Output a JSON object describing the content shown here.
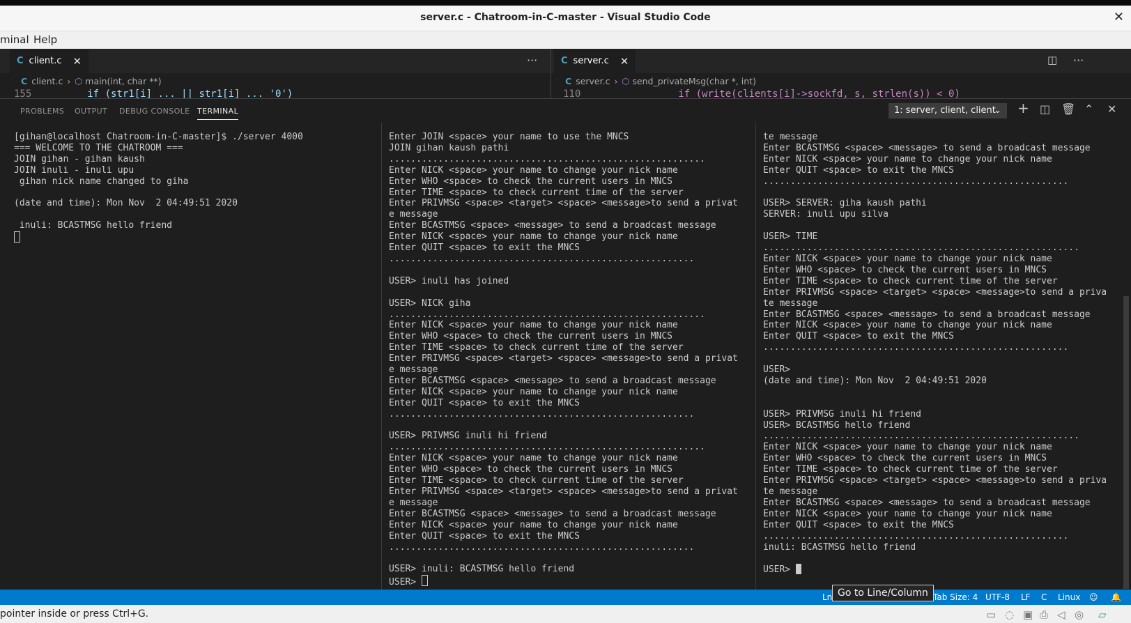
{
  "window": {
    "title": "server.c - Chatroom-in-C-master - Visual Studio Code"
  },
  "menu": [
    "minal",
    "Help"
  ],
  "editor_left": {
    "tab_icon": "C",
    "tab_label": "client.c",
    "breadcrumb_file": "client.c",
    "breadcrumb_symbol": "main(int, char **)",
    "peek_line_no": "155",
    "peek_code": "if (str1[i] ... || str1[i] ... '0')"
  },
  "editor_right": {
    "tab_icon": "C",
    "tab_label": "server.c",
    "breadcrumb_file": "server.c",
    "breadcrumb_symbol": "send_privateMsg(char *, int)",
    "peek_line_no": "110",
    "peek_code": "if (write(clients[i]->sockfd, s, strlen(s)) < 0)"
  },
  "panel": {
    "tabs": [
      "PROBLEMS",
      "OUTPUT",
      "DEBUG CONSOLE",
      "TERMINAL"
    ],
    "terminal_select": "1: server, client, client"
  },
  "terminals": {
    "server": "[gihan@localhost Chatroom-in-C-master]$ ./server 4000\n=== WELCOME TO THE CHATROOM ===\nJOIN gihan - gihan kaush\nJOIN inuli - inuli upu\n gihan nick name changed to giha\n\n(date and time): Mon Nov  2 04:49:51 2020\n\n inuli: BCASTMSG hello friend",
    "client1": "Enter JOIN <space> your name to use the MNCS\nJOIN gihan kaush pathi\n..........................................................\nEnter NICK <space> your name to change your nick name\nEnter WHO <space> to check the current users in MNCS\nEnter TIME <space> to check current time of the server\nEnter PRIVMSG <space> <target> <space> <message>to send a privat\ne message\nEnter BCASTMSG <space> <message> to send a broadcast message\nEnter NICK <space> your name to change your nick name\nEnter QUIT <space> to exit the MNCS\n........................................................\n\nUSER> inuli has joined\n\nUSER> NICK giha\n..........................................................\nEnter NICK <space> your name to change your nick name\nEnter WHO <space> to check the current users in MNCS\nEnter TIME <space> to check current time of the server\nEnter PRIVMSG <space> <target> <space> <message>to send a privat\ne message\nEnter BCASTMSG <space> <message> to send a broadcast message\nEnter NICK <space> your name to change your nick name\nEnter QUIT <space> to exit the MNCS\n........................................................\n\nUSER> PRIVMSG inuli hi friend\n..........................................................\nEnter NICK <space> your name to change your nick name\nEnter WHO <space> to check the current users in MNCS\nEnter TIME <space> to check current time of the server\nEnter PRIVMSG <space> <target> <space> <message>to send a privat\ne message\nEnter BCASTMSG <space> <message> to send a broadcast message\nEnter NICK <space> your name to change your nick name\nEnter QUIT <space> to exit the MNCS\n........................................................\n\nUSER> inuli: BCASTMSG hello friend",
    "client1_prompt": "USER> ",
    "client2": "te message\nEnter BCASTMSG <space> <message> to send a broadcast message\nEnter NICK <space> your name to change your nick name\nEnter QUIT <space> to exit the MNCS\n........................................................\n\nUSER> SERVER: giha kaush pathi\nSERVER: inuli upu silva\n\nUSER> TIME\n..........................................................\nEnter NICK <space> your name to change your nick name\nEnter WHO <space> to check the current users in MNCS\nEnter TIME <space> to check current time of the server\nEnter PRIVMSG <space> <target> <space> <message>to send a priva\nte message\nEnter BCASTMSG <space> <message> to send a broadcast message\nEnter NICK <space> your name to change your nick name\nEnter QUIT <space> to exit the MNCS\n........................................................\n\nUSER>\n(date and time): Mon Nov  2 04:49:51 2020\n\n\nUSER> PRIVMSG inuli hi friend\nUSER> BCASTMSG hello friend\n..........................................................\nEnter NICK <space> your name to change your nick name\nEnter WHO <space> to check the current users in MNCS\nEnter TIME <space> to check current time of the server\nEnter PRIVMSG <space> <target> <space> <message>to send a priva\nte message\nEnter BCASTMSG <space> <message> to send a broadcast message\nEnter NICK <space> your name to change your nick name\nEnter QUIT <space> to exit the MNCS\n........................................................\ninuli: BCASTMSG hello friend\n\n",
    "client2_prompt": "USER> "
  },
  "status": {
    "ln": "Ln",
    "tab_size": "Tab Size: 4",
    "encoding": "UTF-8",
    "eol": "LF",
    "lang": "C",
    "os": "Linux"
  },
  "tooltip": "Go to Line/Column",
  "bottom_message": "pointer inside or press Ctrl+G."
}
